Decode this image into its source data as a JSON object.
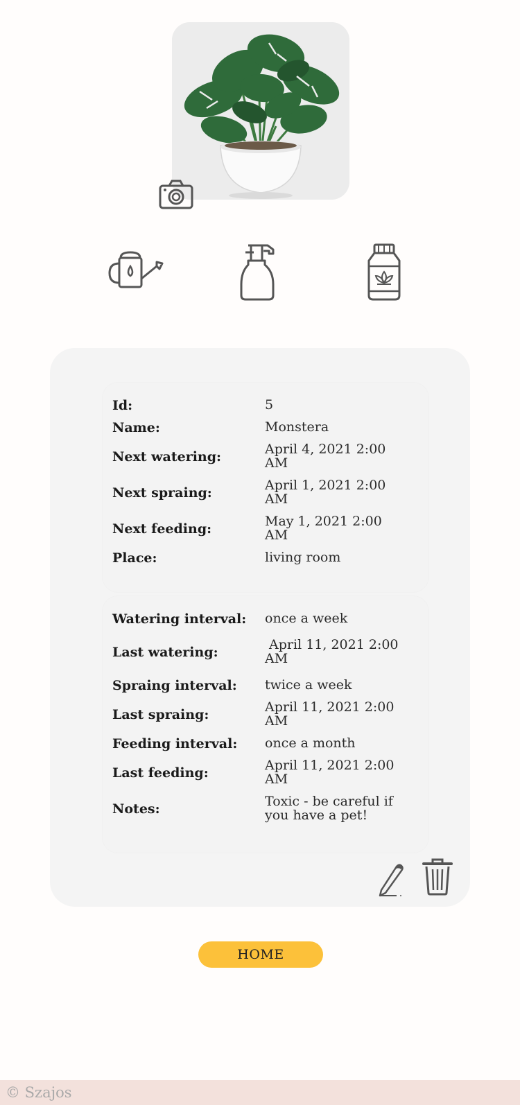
{
  "plant": {
    "photo_alt": "Monstera plant in white pot"
  },
  "actions": {
    "camera_icon": "camera-icon",
    "water_icon": "watering-can-icon",
    "spray_icon": "spray-bottle-icon",
    "feed_icon": "fertilizer-jar-icon",
    "edit_icon": "pencil-icon",
    "delete_icon": "trash-icon"
  },
  "details": {
    "main": [
      {
        "label": "Id:",
        "value": "5"
      },
      {
        "label": "Name:",
        "value": "Monstera"
      },
      {
        "label": "Next watering:",
        "value": "April 4, 2021 2:00 AM"
      },
      {
        "label": "Next spraing:",
        "value": "April 1, 2021 2:00 AM"
      },
      {
        "label": "Next feeding:",
        "value": "May 1, 2021 2:00 AM"
      },
      {
        "label": "Place:",
        "value": "living room"
      }
    ],
    "care": [
      {
        "label": "Watering interval:",
        "value": "once a week"
      },
      {
        "label": "Last watering:",
        "value": " April 11, 2021 2:00 AM"
      },
      {
        "label": "Spraing interval:",
        "value": "twice a week"
      },
      {
        "label": "Last spraing:",
        "value": "April 11, 2021 2:00 AM"
      },
      {
        "label": "Feeding interval:",
        "value": "once a month"
      },
      {
        "label": "Last feeding:",
        "value": "April 11, 2021 2:00 AM"
      },
      {
        "label": "Notes:",
        "value": "Toxic - be careful if you have a pet!"
      }
    ]
  },
  "home_button": {
    "label": "HOME"
  },
  "footer": {
    "text": "© Szajos"
  },
  "colors": {
    "accent": "#fcc13a",
    "card": "#f4f4f4",
    "footer": "#f3e1dc",
    "leaf": "#2f6b3a"
  }
}
